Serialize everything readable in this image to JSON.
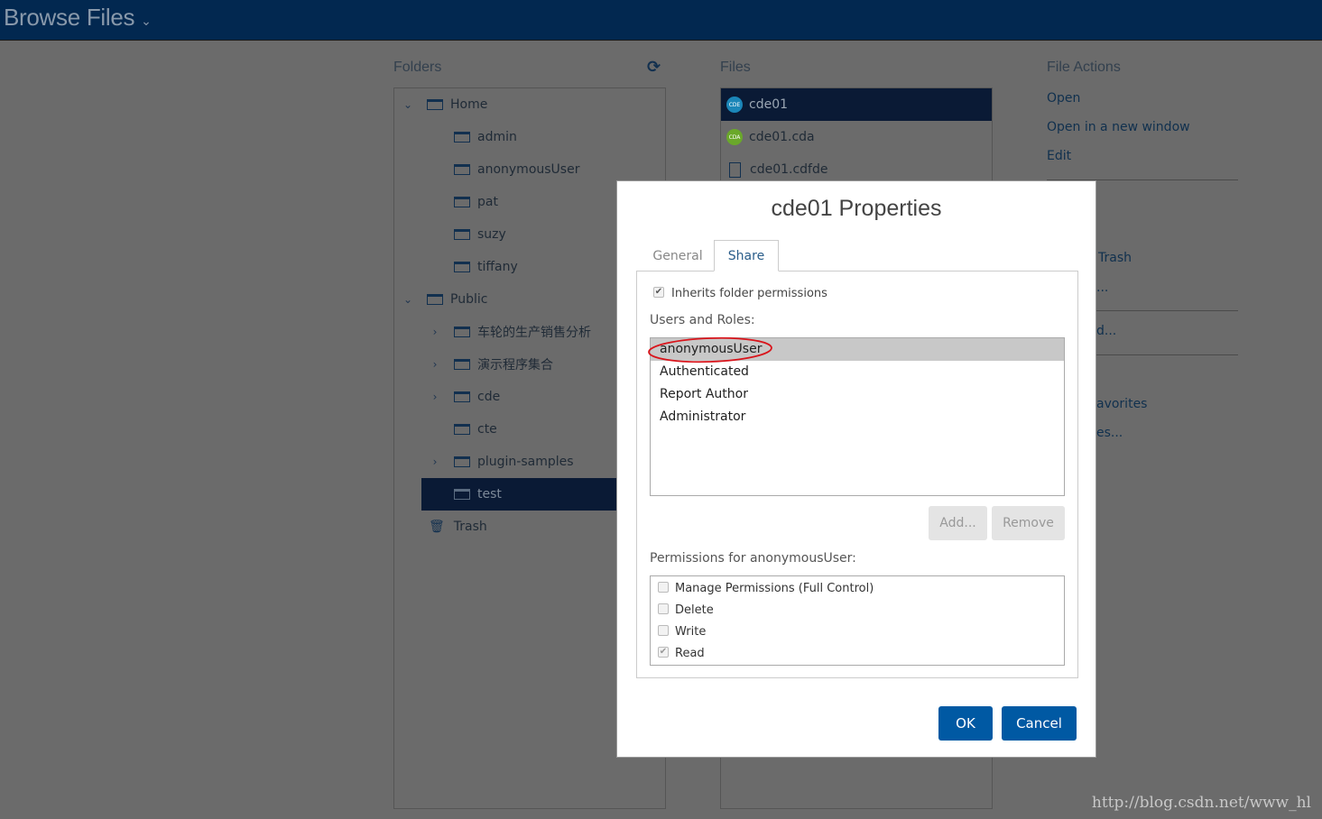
{
  "header": {
    "title": "Browse Files",
    "title_chevron": "⌄"
  },
  "folders": {
    "label": "Folders",
    "refresh_icon": "refresh-icon",
    "items": [
      {
        "label": "Home",
        "level": 0,
        "expander": "⌄",
        "open": true
      },
      {
        "label": "admin",
        "level": 1,
        "expander": ""
      },
      {
        "label": "anonymousUser",
        "level": 1,
        "expander": ""
      },
      {
        "label": "pat",
        "level": 1,
        "expander": ""
      },
      {
        "label": "suzy",
        "level": 1,
        "expander": ""
      },
      {
        "label": "tiffany",
        "level": 1,
        "expander": ""
      },
      {
        "label": "Public",
        "level": 0,
        "expander": "⌄",
        "open": true
      },
      {
        "label": "车轮的生产销售分析",
        "level": 1,
        "expander": "›"
      },
      {
        "label": "演示程序集合",
        "level": 1,
        "expander": "›"
      },
      {
        "label": "cde",
        "level": 1,
        "expander": "›"
      },
      {
        "label": "cte",
        "level": 1,
        "expander": ""
      },
      {
        "label": "plugin-samples",
        "level": 1,
        "expander": "›"
      },
      {
        "label": "test",
        "level": 1,
        "expander": "",
        "selected": true
      }
    ],
    "trash_label": "Trash"
  },
  "files": {
    "label": "Files",
    "items": [
      {
        "label": "cde01",
        "icon": "CDE",
        "icon_color": "#1b86b8",
        "selected": true
      },
      {
        "label": "cde01.cda",
        "icon": "CDA",
        "icon_color": "#6aa82a"
      },
      {
        "label": "cde01.cdfde",
        "icon": "file"
      }
    ]
  },
  "actions": {
    "label": "File Actions",
    "items": [
      "Open",
      "Open in a new window",
      "Edit"
    ],
    "partial_items": [
      "Trash",
      "...",
      "d...",
      "avorites",
      "es..."
    ]
  },
  "dialog": {
    "title": "cde01 Properties",
    "tabs": [
      {
        "label": "General",
        "active": false
      },
      {
        "label": "Share",
        "active": true
      }
    ],
    "inherits_label": "Inherits folder permissions",
    "inherits_checked": true,
    "users_label": "Users and Roles:",
    "users": [
      "anonymousUser",
      "Authenticated",
      "Report Author",
      "Administrator"
    ],
    "selected_user": "anonymousUser",
    "add_label": "Add...",
    "remove_label": "Remove",
    "permissions_label": "Permissions for anonymousUser:",
    "permissions": [
      {
        "label": "Manage Permissions (Full Control)",
        "checked": false
      },
      {
        "label": "Delete",
        "checked": false
      },
      {
        "label": "Write",
        "checked": false
      },
      {
        "label": "Read",
        "checked": true
      }
    ],
    "ok_label": "OK",
    "cancel_label": "Cancel",
    "annotation_color": "#d9141b"
  },
  "colors": {
    "header": "#022850",
    "selected": "#0a1a35",
    "primary_button": "#0059a3"
  },
  "watermark": "http://blog.csdn.net/www_hl"
}
